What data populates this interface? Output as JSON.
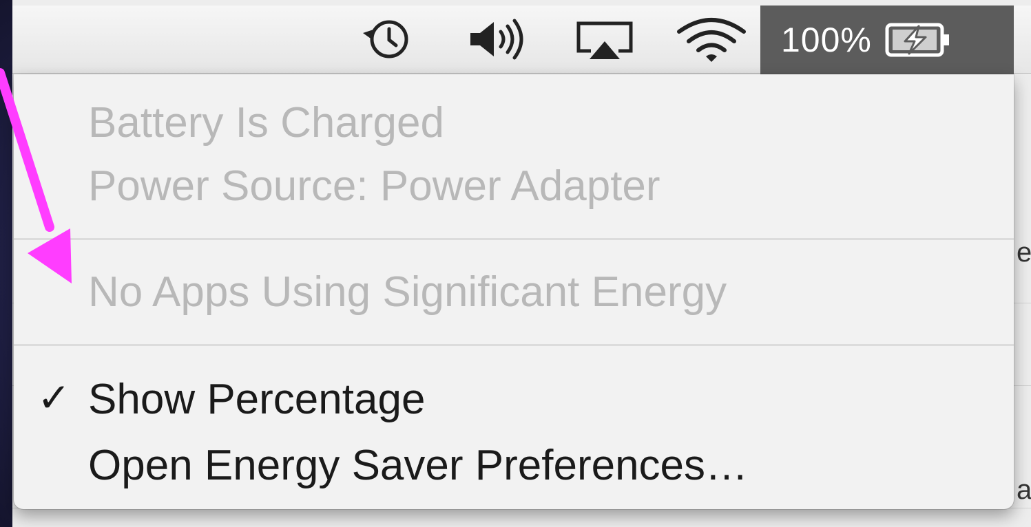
{
  "menubar": {
    "icons": [
      "time-machine-icon",
      "volume-icon",
      "airplay-icon",
      "wifi-icon"
    ],
    "battery": {
      "percentage_label": "100%",
      "icon": "battery-charging-icon",
      "selected": true
    }
  },
  "battery_menu": {
    "status": {
      "charge_label": "Battery Is Charged",
      "power_source_label": "Power Source: Power Adapter"
    },
    "energy": {
      "apps_label": "No Apps Using Significant Energy"
    },
    "options": {
      "show_percentage_label": "Show Percentage",
      "show_percentage_checked": true,
      "open_prefs_label": "Open Energy Saver Preferences…"
    }
  },
  "background": {
    "peek_text_1": "e",
    "peek_text_2": "a"
  },
  "annotation": {
    "arrow_color": "#ff3dff"
  }
}
